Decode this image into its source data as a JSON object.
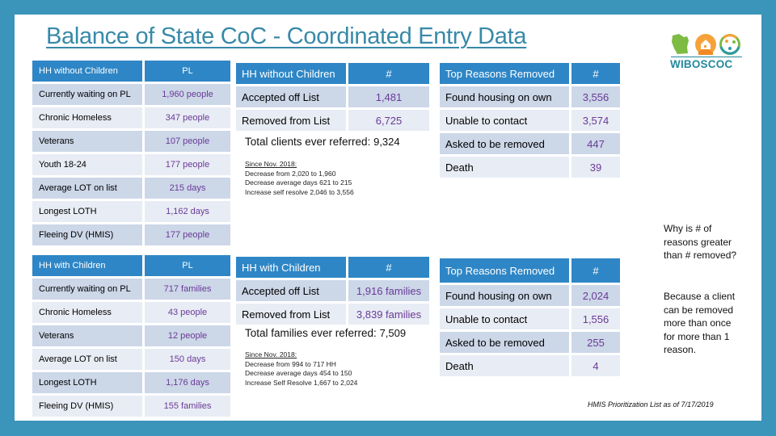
{
  "title": "Balance of State CoC - Coordinated Entry Data",
  "logo": {
    "text": "WIBOSCOC",
    "icons": [
      "wisconsin-state-icon",
      "house-icon",
      "people-circle-icon"
    ]
  },
  "left_top": {
    "headers": [
      "HH without Children",
      "PL"
    ],
    "rows": [
      [
        "Currently waiting on PL",
        "1,960 people"
      ],
      [
        "Chronic Homeless",
        "347 people"
      ],
      [
        "Veterans",
        "107 people"
      ],
      [
        "Youth 18-24",
        "177 people"
      ],
      [
        "Average LOT on list",
        "215 days"
      ],
      [
        "Longest LOTH",
        "1,162 days"
      ],
      [
        "Fleeing DV (HMIS)",
        "177 people"
      ]
    ]
  },
  "left_bot": {
    "headers": [
      "HH with Children",
      "PL"
    ],
    "rows": [
      [
        "Currently waiting on PL",
        "717 families"
      ],
      [
        "Chronic Homeless",
        "43 people"
      ],
      [
        "Veterans",
        "12 people"
      ],
      [
        "Average LOT on list",
        "150 days"
      ],
      [
        "Longest LOTH",
        "1,176 days"
      ],
      [
        "Fleeing DV (HMIS)",
        "155 families"
      ]
    ]
  },
  "mid_top": {
    "headers": [
      "HH without Children",
      "#"
    ],
    "rows": [
      [
        "Accepted off List",
        "1,481"
      ],
      [
        "Removed from List",
        "6,725"
      ]
    ],
    "total_label": "Total clients ever referred:",
    "total_value": "9,324",
    "since": {
      "header": "Since Nov. 2018:",
      "lines": [
        "Decrease from 2,020 to 1,960",
        "Decrease average days 621 to 215",
        "Increase self resolve 2,046 to 3,556"
      ]
    }
  },
  "mid_bot": {
    "headers": [
      "HH with Children",
      "#"
    ],
    "rows": [
      [
        "Accepted off List",
        "1,916 families"
      ],
      [
        "Removed from List",
        "3,839 families"
      ]
    ],
    "total_label": "Total families ever referred:",
    "total_value": "7,509",
    "since": {
      "header": "Since Nov. 2018:",
      "lines": [
        "Decrease from 994 to 717 HH",
        "Decrease average days 454 to 150",
        "Increase Self Resolve 1,667 to 2,024"
      ]
    }
  },
  "right_top": {
    "headers": [
      "Top Reasons Removed",
      "#"
    ],
    "rows": [
      [
        "Found housing on own",
        "3,556"
      ],
      [
        "Unable to contact",
        "3,574"
      ],
      [
        "Asked to be removed",
        "447"
      ],
      [
        "Death",
        "39"
      ]
    ]
  },
  "right_bot": {
    "headers": [
      "Top Reasons Removed",
      "#"
    ],
    "rows": [
      [
        "Found housing on own",
        "2,024"
      ],
      [
        "Unable to contact",
        "1,556"
      ],
      [
        "Asked to be removed",
        "255"
      ],
      [
        "Death",
        "4"
      ]
    ]
  },
  "note": {
    "question": "Why is # of reasons greater than # removed?",
    "answer": "Because a client can be removed more than once for more than 1 reason."
  },
  "footer": "HMIS Prioritization List as of 7/17/2019",
  "colors": {
    "background": "#3b94b9",
    "title": "#3889a8",
    "header": "#2e86c6",
    "row_odd": "#ccd7e8",
    "row_even": "#e8ecf4",
    "value_text": "#6a3a97",
    "logo_text": "#25899e"
  }
}
